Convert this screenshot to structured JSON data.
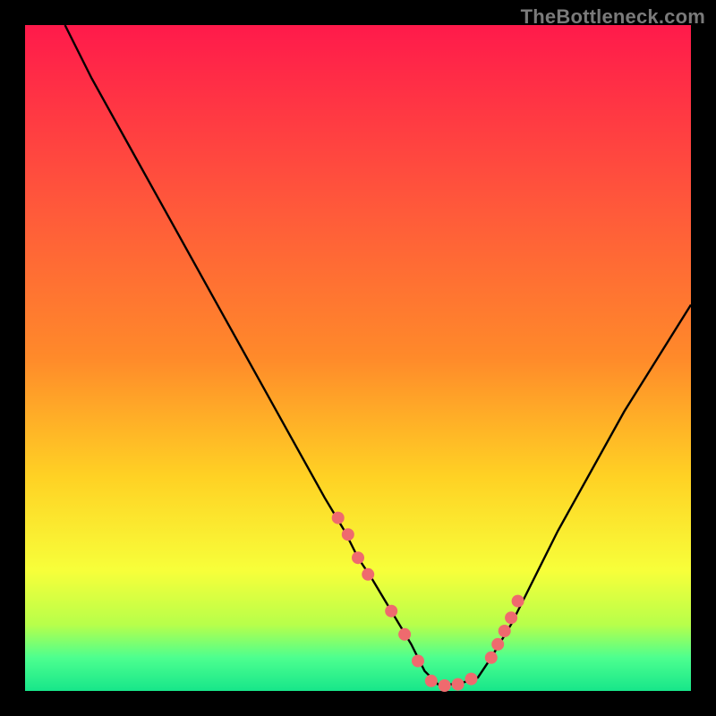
{
  "watermark": "TheBottleneck.com",
  "colors": {
    "bg": "#000000",
    "curve": "#000000",
    "dot": "#ef6a6e",
    "grad_top": "#ff1a4b",
    "grad_mid_upper": "#ff8a2a",
    "grad_mid": "#ffd224",
    "grad_lower": "#f7ff3a",
    "grad_green1": "#b8ff4a",
    "grad_green2": "#4dff8f",
    "grad_green3": "#17e68a"
  },
  "chart_data": {
    "type": "line",
    "title": "",
    "xlabel": "",
    "ylabel": "",
    "xlim": [
      0,
      100
    ],
    "ylim": [
      0,
      100
    ],
    "notes": "V-shaped bottleneck curve. X is an unlabeled parameter sweep (approx 0–100). Y is an unlabeled bottleneck metric (approx 0–100, lower is better). Minimum near x≈62. Pink dots highlight the low region of the curve.",
    "series": [
      {
        "name": "curve",
        "x": [
          6,
          10,
          15,
          20,
          25,
          30,
          35,
          40,
          45,
          48,
          50,
          52,
          55,
          58,
          60,
          62,
          65,
          68,
          70,
          73,
          76,
          80,
          85,
          90,
          95,
          100
        ],
        "y": [
          100,
          92,
          83,
          74,
          65,
          56,
          47,
          38,
          29,
          24,
          20,
          17,
          12,
          7,
          3,
          1,
          1,
          2,
          5,
          10,
          16,
          24,
          33,
          42,
          50,
          58
        ]
      },
      {
        "name": "highlight_dots",
        "x": [
          47,
          48.5,
          50,
          51.5,
          55,
          57,
          59,
          61,
          63,
          65,
          67,
          70,
          71,
          72,
          73,
          74
        ],
        "y": [
          26,
          23.5,
          20,
          17.5,
          12,
          8.5,
          4.5,
          1.5,
          0.8,
          1,
          1.8,
          5,
          7,
          9,
          11,
          13.5
        ]
      }
    ]
  }
}
